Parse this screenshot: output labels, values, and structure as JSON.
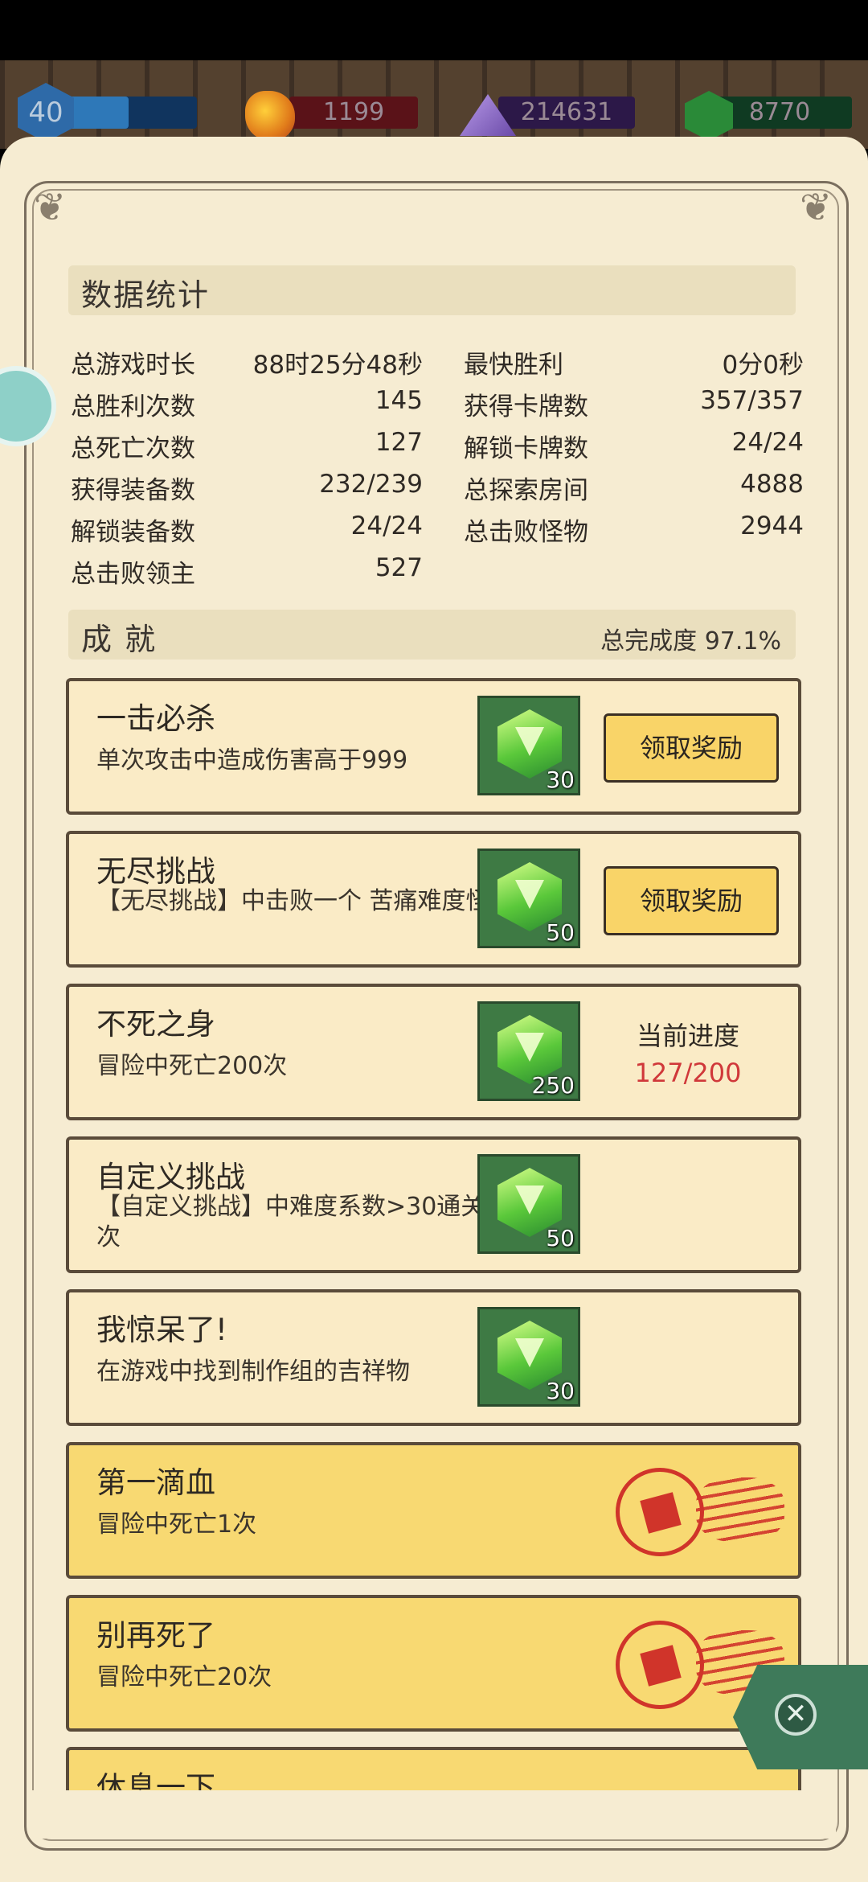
{
  "resources": {
    "level": "40",
    "level_progress": 0.55,
    "ore": "1199",
    "crystal": "214631",
    "gems": "8770"
  },
  "stats": {
    "title": "数据统计",
    "left": [
      {
        "label": "总游戏时长",
        "value": "88时25分48秒"
      },
      {
        "label": "总胜利次数",
        "value": "145"
      },
      {
        "label": "总死亡次数",
        "value": "127"
      },
      {
        "label": "获得装备数",
        "value": "232/239"
      },
      {
        "label": "解锁装备数",
        "value": "24/24"
      },
      {
        "label": "总击败领主",
        "value": "527"
      }
    ],
    "right": [
      {
        "label": "最快胜利",
        "value": "0分0秒"
      },
      {
        "label": "获得卡牌数",
        "value": "357/357"
      },
      {
        "label": "解锁卡牌数",
        "value": "24/24"
      },
      {
        "label": "总探索房间",
        "value": "4888"
      },
      {
        "label": "总击败怪物",
        "value": "2944"
      }
    ]
  },
  "achievements": {
    "title": "成 就",
    "completion": "总完成度 97.1%",
    "items": [
      {
        "name": "一击必杀",
        "desc": "单次攻击中造成伤害高于999",
        "reward": "30",
        "action": "领取奖励"
      },
      {
        "name": "无尽挑战",
        "desc": "【无尽挑战】中击败一个 苦痛难度怪物",
        "reward": "50",
        "action": "领取奖励"
      },
      {
        "name": "不死之身",
        "desc": "冒险中死亡200次",
        "reward": "250",
        "progress_label": "当前进度",
        "progress": "127/200"
      },
      {
        "name": "自定义挑战",
        "desc": "【自定义挑战】中难度系数>30通关一次",
        "reward": "50"
      },
      {
        "name": "我惊呆了!",
        "desc": "在游戏中找到制作组的吉祥物",
        "reward": "30"
      },
      {
        "name": "第一滴血",
        "desc": "冒险中死亡1次"
      },
      {
        "name": "别再死了",
        "desc": "冒险中死亡20次"
      },
      {
        "name": "休息一下"
      }
    ]
  },
  "colors": {
    "parchment": "#f6ecd2",
    "card": "#faebc6",
    "card_done": "#f8d972",
    "progress_red": "#d0383a"
  }
}
